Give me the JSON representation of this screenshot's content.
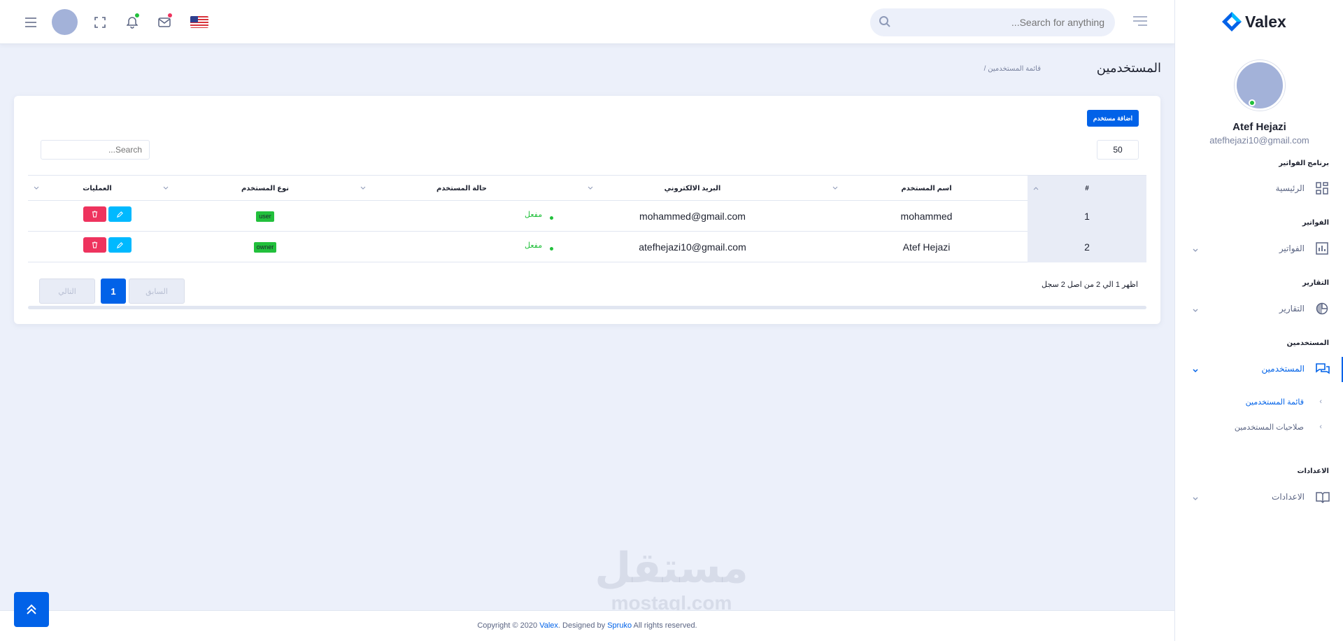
{
  "header": {
    "search_placeholder": "...Search for anything"
  },
  "sidebar": {
    "logo_text": "Valex",
    "user_name": "Atef Hejazi",
    "user_email": "atefhejazi10@gmail.com",
    "sections": [
      {
        "category": "برنامج الفواتير",
        "item": "الرئيسية"
      },
      {
        "category": "الفواتير",
        "item": "الفواتير"
      },
      {
        "category": "التقارير",
        "item": "التقارير"
      },
      {
        "category": "المستخدمين",
        "item": "المستخدمين"
      },
      {
        "category": "الاعدادات",
        "item": "الاعدادات"
      }
    ],
    "subitems": [
      "قائمة المستخدمين",
      "صلاحيات المستخدمين"
    ]
  },
  "page": {
    "title": "المستخدمين",
    "breadcrumb": "/ قائمة المستخدمين"
  },
  "card": {
    "add_button": "اضافة مستخدم",
    "page_length": "50",
    "search_placeholder": "...Search",
    "columns": [
      "#",
      "اسم المستخدم",
      "البريد الالكتروني",
      "حالة المستخدم",
      "نوع المستخدم",
      "العمليات"
    ],
    "rows": [
      {
        "id": "1",
        "name": "mohammed",
        "email": "mohammed@gmail.com",
        "status": "مفعل",
        "type": "user"
      },
      {
        "id": "2",
        "name": "Atef Hejazi",
        "email": "atefhejazi10@gmail.com",
        "status": "مفعل",
        "type": "owner"
      }
    ],
    "info": "اظهر 1 الي 2 من اصل 2 سجل",
    "prev": "السابق",
    "page": "1",
    "next": "التالي"
  },
  "footer": {
    "prefix": "Copyright © 2020 ",
    "brand": "Valex",
    "middle": ". Designed by ",
    "designer": "Spruko",
    "suffix": " All rights reserved."
  },
  "watermark": {
    "ar": "مستقل",
    "en": "mostaql.com"
  },
  "colors": {
    "primary": "#0162e8",
    "success": "#22c03c",
    "danger": "#ee335e",
    "info": "#00b9ff"
  }
}
